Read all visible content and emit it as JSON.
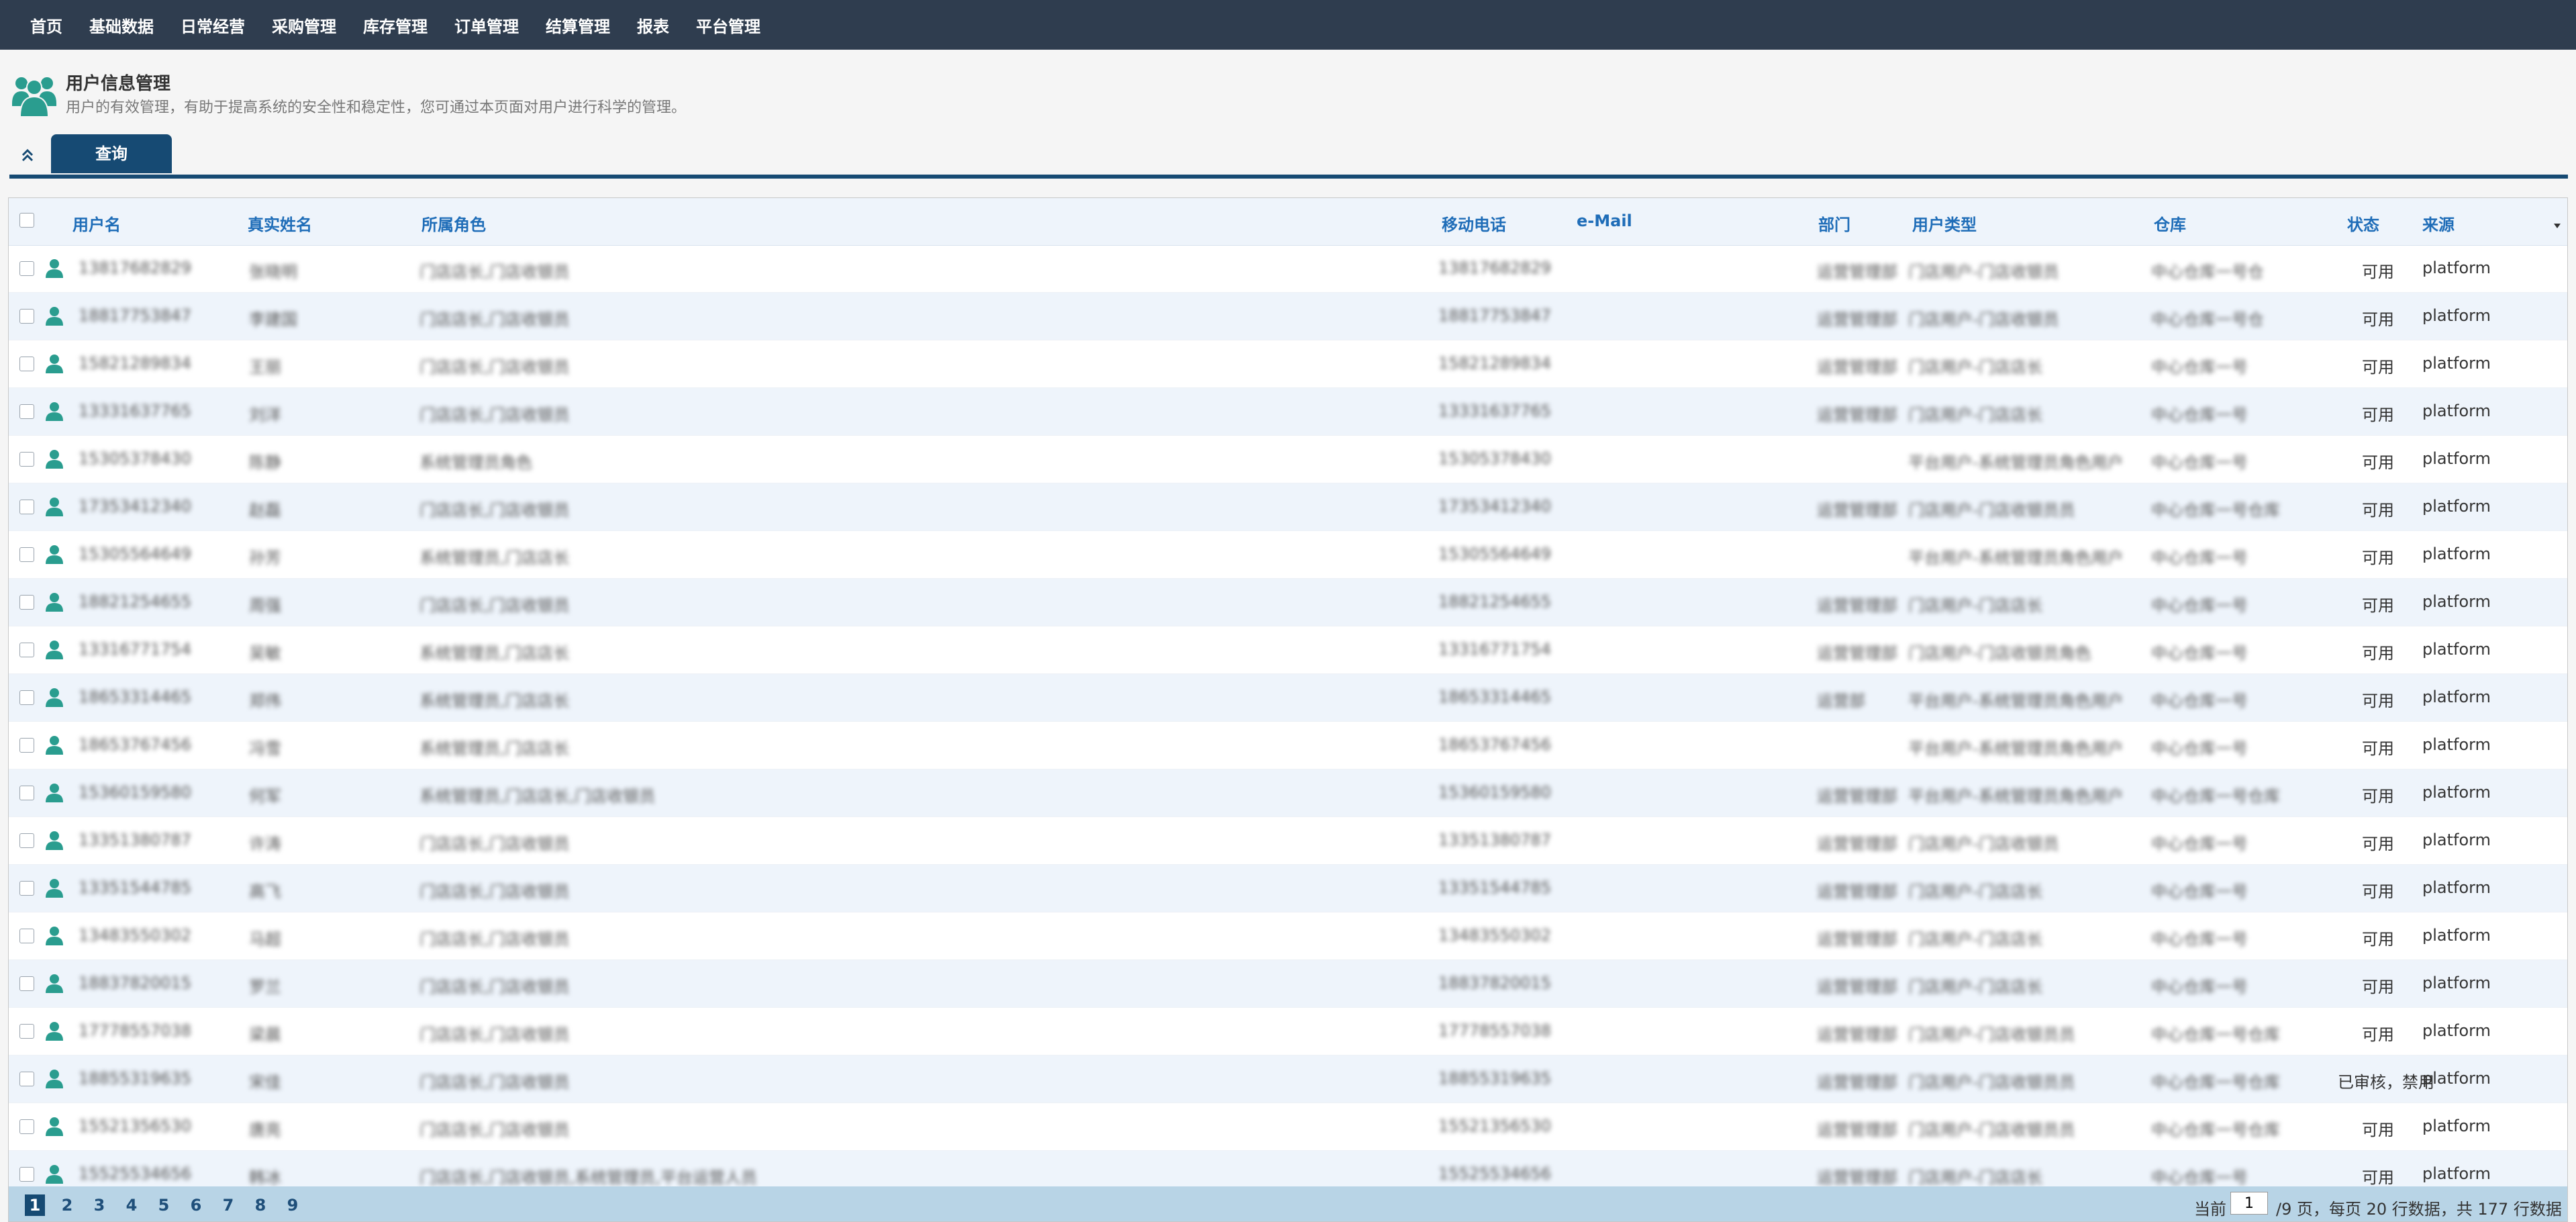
{
  "nav": [
    "首页",
    "基础数据",
    "日常经营",
    "采购管理",
    "库存管理",
    "订单管理",
    "结算管理",
    "报表",
    "平台管理"
  ],
  "header": {
    "title": "用户信息管理",
    "description": "用户的有效管理，有助于提高系统的安全性和稳定性，您可通过本页面对用户进行科学的管理。"
  },
  "tabs": {
    "query": "查询"
  },
  "columns": [
    "用户名",
    "真实姓名",
    "所属角色",
    "移动电话",
    "e-Mail",
    "部门",
    "用户类型",
    "仓库",
    "状态",
    "来源"
  ],
  "rows": [
    {
      "username": "13817682829",
      "realname": "张晓明",
      "role": "门店店长,门店收银员",
      "mobile": "13817682829",
      "dept": "运营管理部",
      "usertype": "门店用户-门店收银员",
      "warehouse": "中心仓库一号仓",
      "status": "可用",
      "source": "platform"
    },
    {
      "username": "18817753847",
      "realname": "李建国",
      "role": "门店店长,门店收银员",
      "mobile": "18817753847",
      "dept": "运营管理部",
      "usertype": "门店用户-门店收银员",
      "warehouse": "中心仓库一号仓",
      "status": "可用",
      "source": "platform"
    },
    {
      "username": "15821289834",
      "realname": "王丽",
      "role": "门店店长,门店收银员",
      "mobile": "15821289834",
      "dept": "运营管理部",
      "usertype": "门店用户-门店店长",
      "warehouse": "中心仓库一号",
      "status": "可用",
      "source": "platform"
    },
    {
      "username": "13331637765",
      "realname": "刘洋",
      "role": "门店店长,门店收银员",
      "mobile": "13331637765",
      "dept": "运营管理部",
      "usertype": "门店用户-门店店长",
      "warehouse": "中心仓库一号",
      "status": "可用",
      "source": "platform"
    },
    {
      "username": "15305378430",
      "realname": "陈静",
      "role": "系统管理员角色",
      "mobile": "15305378430",
      "dept": "",
      "usertype": "平台用户-系统管理员角色用户",
      "warehouse": "中心仓库一号",
      "status": "可用",
      "source": "platform"
    },
    {
      "username": "17353412340",
      "realname": "赵磊",
      "role": "门店店长,门店收银员",
      "mobile": "17353412340",
      "dept": "运营管理部",
      "usertype": "门店用户-门店收银员员",
      "warehouse": "中心仓库一号仓库",
      "status": "可用",
      "source": "platform"
    },
    {
      "username": "15305564649",
      "realname": "孙芳",
      "role": "系统管理员,门店店长",
      "mobile": "15305564649",
      "dept": "",
      "usertype": "平台用户-系统管理员角色用户",
      "warehouse": "中心仓库一号",
      "status": "可用",
      "source": "platform"
    },
    {
      "username": "18821254655",
      "realname": "周强",
      "role": "门店店长,门店收银员",
      "mobile": "18821254655",
      "dept": "运营管理部",
      "usertype": "门店用户-门店店长",
      "warehouse": "中心仓库一号",
      "status": "可用",
      "source": "platform"
    },
    {
      "username": "13316771754",
      "realname": "吴敏",
      "role": "系统管理员,门店店长",
      "mobile": "13316771754",
      "dept": "运营管理部",
      "usertype": "门店用户-门店收银员角色",
      "warehouse": "中心仓库一号",
      "status": "可用",
      "source": "platform"
    },
    {
      "username": "18653314465",
      "realname": "郑伟",
      "role": "系统管理员,门店店长",
      "mobile": "18653314465",
      "dept": "运营部",
      "usertype": "平台用户-系统管理员角色用户",
      "warehouse": "中心仓库一号",
      "status": "可用",
      "source": "platform"
    },
    {
      "username": "18653767456",
      "realname": "冯雪",
      "role": "系统管理员,门店店长",
      "mobile": "18653767456",
      "dept": "",
      "usertype": "平台用户-系统管理员角色用户",
      "warehouse": "中心仓库一号",
      "status": "可用",
      "source": "platform"
    },
    {
      "username": "15360159580",
      "realname": "何军",
      "role": "系统管理员,门店店长,门店收银员",
      "mobile": "15360159580",
      "dept": "运营管理部",
      "usertype": "平台用户-系统管理员角色用户",
      "warehouse": "中心仓库一号仓库",
      "status": "可用",
      "source": "platform"
    },
    {
      "username": "13351380787",
      "realname": "许涛",
      "role": "门店店长,门店收银员",
      "mobile": "13351380787",
      "dept": "运营管理部",
      "usertype": "门店用户-门店收银员",
      "warehouse": "中心仓库一号",
      "status": "可用",
      "source": "platform"
    },
    {
      "username": "13351544785",
      "realname": "高飞",
      "role": "门店店长,门店收银员",
      "mobile": "13351544785",
      "dept": "运营管理部",
      "usertype": "门店用户-门店店长",
      "warehouse": "中心仓库一号",
      "status": "可用",
      "source": "platform"
    },
    {
      "username": "13483550302",
      "realname": "马超",
      "role": "门店店长,门店收银员",
      "mobile": "13483550302",
      "dept": "运营管理部",
      "usertype": "门店用户-门店店长",
      "warehouse": "中心仓库一号",
      "status": "可用",
      "source": "platform"
    },
    {
      "username": "18837820015",
      "realname": "罗兰",
      "role": "门店店长,门店收银员",
      "mobile": "18837820015",
      "dept": "运营管理部",
      "usertype": "门店用户-门店店长",
      "warehouse": "中心仓库一号",
      "status": "可用",
      "source": "platform"
    },
    {
      "username": "17778557038",
      "realname": "梁晨",
      "role": "门店店长,门店收银员",
      "mobile": "17778557038",
      "dept": "运营管理部",
      "usertype": "门店用户-门店收银员员",
      "warehouse": "中心仓库一号仓库",
      "status": "可用",
      "source": "platform"
    },
    {
      "username": "18855319635",
      "realname": "宋佳",
      "role": "门店店长,门店收银员",
      "mobile": "18855319635",
      "dept": "运营管理部",
      "usertype": "门店用户-门店收银员员",
      "warehouse": "中心仓库一号仓库",
      "status": "已审核，禁用",
      "source": "platform"
    },
    {
      "username": "15521356530",
      "realname": "唐亮",
      "role": "门店店长,门店收银员",
      "mobile": "15521356530",
      "dept": "运营管理部",
      "usertype": "门店用户-门店收银员员",
      "warehouse": "中心仓库一号仓库",
      "status": "可用",
      "source": "platform"
    },
    {
      "username": "15525534656",
      "realname": "韩冰",
      "role": "门店店长,门店收银员,系统管理员,平台运营人员",
      "mobile": "15525534656",
      "dept": "运营管理部",
      "usertype": "门店用户-门店店长",
      "warehouse": "中心仓库一号",
      "status": "可用",
      "source": "platform"
    }
  ],
  "pagination": {
    "pages": [
      "1",
      "2",
      "3",
      "4",
      "5",
      "6",
      "7",
      "8",
      "9"
    ],
    "current_label": "当前",
    "current_value": "1",
    "summary": "/9 页，每页 20 行数据，共 177 行数据"
  },
  "colors": {
    "nav_bg": "#2f3d4f",
    "accent": "#164a73",
    "header_text": "#1f6db8",
    "user_icon": "#2a9d8f"
  }
}
